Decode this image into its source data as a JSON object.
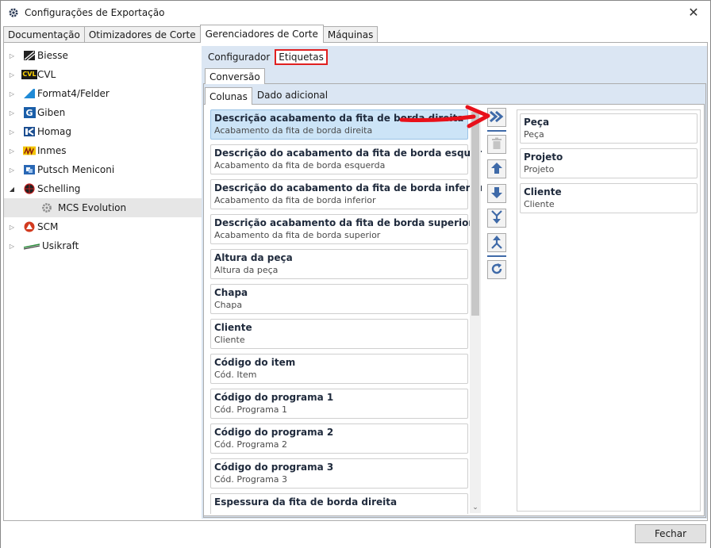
{
  "window": {
    "title": "Configurações de Exportação",
    "close_glyph": "✕"
  },
  "main_tabs": [
    {
      "label": "Documentação"
    },
    {
      "label": "Otimizadores de Corte"
    },
    {
      "label": "Gerenciadores de Corte"
    },
    {
      "label": "Máquinas"
    }
  ],
  "tree": [
    {
      "label": "Biesse",
      "icon": "biesse-logo-icon"
    },
    {
      "label": "CVL",
      "icon": "cvl-logo-icon",
      "badge": "CVL"
    },
    {
      "label": "Format4/Felder",
      "icon": "format4-logo-icon"
    },
    {
      "label": "Giben",
      "icon": "giben-logo-icon",
      "badge": "G"
    },
    {
      "label": "Homag",
      "icon": "homag-logo-icon"
    },
    {
      "label": "Inmes",
      "icon": "inmes-logo-icon"
    },
    {
      "label": "Putsch Meniconi",
      "icon": "putsch-logo-icon"
    },
    {
      "label": "Schelling",
      "icon": "schelling-logo-icon"
    },
    {
      "label": "MCS Evolution",
      "icon": "gear-icon"
    },
    {
      "label": "SCM",
      "icon": "scm-logo-icon"
    },
    {
      "label": "Usikraft",
      "icon": "usikraft-logo-icon"
    }
  ],
  "sub_tabs": [
    {
      "label": "Configurador"
    },
    {
      "label": "Etiquetas"
    }
  ],
  "conversion_tab": "Conversão",
  "column_tabs": [
    {
      "label": "Colunas"
    },
    {
      "label": "Dado adicional"
    }
  ],
  "available_columns": [
    {
      "title": "Descrição acabamento da fita de borda direita",
      "subtitle": "Acabamento da fita de borda direita"
    },
    {
      "title": "Descrição do acabamento da fita de borda esquerda",
      "subtitle": "Acabamento da fita de borda esquerda"
    },
    {
      "title": "Descrição do acabamento da fita de borda inferior",
      "subtitle": "Acabamento da fita de borda inferior"
    },
    {
      "title": "Descrição acabamento da fita de borda superior",
      "subtitle": "Acabamento da fita de borda superior"
    },
    {
      "title": "Altura da peça",
      "subtitle": "Altura da peça"
    },
    {
      "title": "Chapa",
      "subtitle": "Chapa"
    },
    {
      "title": "Cliente",
      "subtitle": "Cliente"
    },
    {
      "title": "Código do item",
      "subtitle": "Cód. Item"
    },
    {
      "title": "Código do programa 1",
      "subtitle": "Cód. Programa 1"
    },
    {
      "title": "Código do programa 2",
      "subtitle": "Cód. Programa 2"
    },
    {
      "title": "Código do programa 3",
      "subtitle": "Cód. Programa 3"
    },
    {
      "title": "Espessura da fita de borda direita",
      "subtitle": ""
    }
  ],
  "selected_columns": [
    {
      "title": "Peça",
      "subtitle": "Peça"
    },
    {
      "title": "Projeto",
      "subtitle": "Projeto"
    },
    {
      "title": "Cliente",
      "subtitle": "Cliente"
    }
  ],
  "toolbar_icons": [
    "add-all-icon",
    "delete-icon",
    "move-up-icon",
    "move-down-icon",
    "move-bottom-icon",
    "move-top-icon",
    "refresh-icon"
  ],
  "footer": {
    "close_label": "Fechar"
  },
  "colors": {
    "accent": "#3f6aa8",
    "highlight_box": "#e02020",
    "selection": "#cce4f7",
    "panel_bg": "#dbe6f3"
  }
}
